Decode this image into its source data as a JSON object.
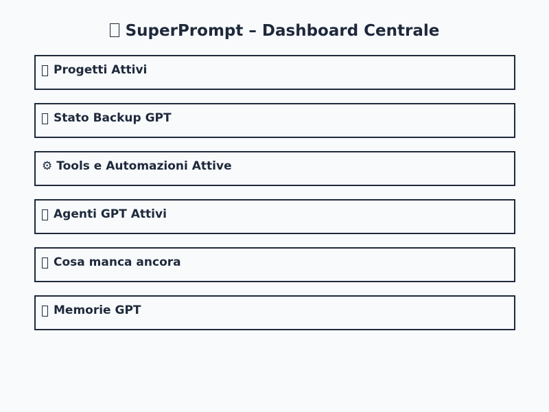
{
  "page": {
    "title": "SuperPrompt – Dashboard Centrale",
    "title_icon": "missing-glyph-icon"
  },
  "sections": [
    {
      "label": "Progetti Attivi",
      "icon": "missing-glyph-icon"
    },
    {
      "label": "Stato Backup GPT",
      "icon": "missing-glyph-icon"
    },
    {
      "label": "Tools e Automazioni Attive",
      "icon": "gear-icon",
      "glyph": "⚙"
    },
    {
      "label": "Agenti GPT Attivi",
      "icon": "missing-glyph-icon"
    },
    {
      "label": "Cosa manca ancora",
      "icon": "missing-glyph-icon"
    },
    {
      "label": "Memorie GPT",
      "icon": "missing-glyph-icon"
    }
  ],
  "colors": {
    "background": "#f8fafc",
    "text": "#1e293b",
    "border": "#1e293b"
  }
}
